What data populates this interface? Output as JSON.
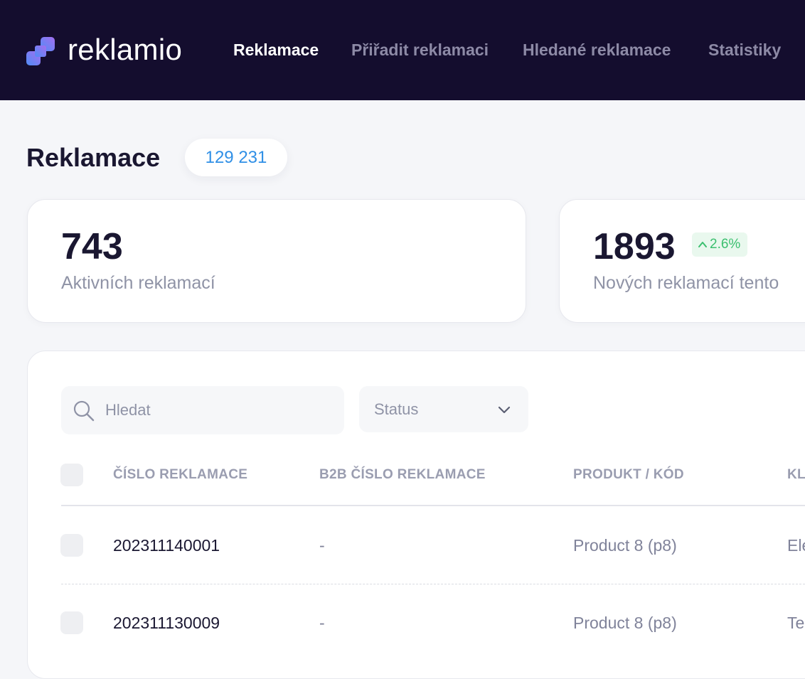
{
  "app": {
    "brand": "reklamio",
    "colors": {
      "nav_background": "#140d2e",
      "accent_blue": "#2f8fe6",
      "trend_green": "#3bbf6f",
      "logo_gradient": [
        "#4f8df6",
        "#a46ef0"
      ]
    }
  },
  "nav": {
    "items": [
      {
        "label": "Reklamace",
        "active": true
      },
      {
        "label": "Přiřadit reklamaci",
        "active": false
      },
      {
        "label": "Hledané reklamace",
        "active": false
      },
      {
        "label": "Statistiky",
        "active": false
      }
    ]
  },
  "page": {
    "title": "Reklamace",
    "total_count": "129 231"
  },
  "stats": [
    {
      "value": "743",
      "label": "Aktivních reklamací"
    },
    {
      "value": "1893",
      "label": "Nových reklamací tento",
      "trend": "2.6%",
      "trend_direction": "up",
      "trend_icon": "arrow-up-icon"
    }
  ],
  "filters": {
    "search_placeholder": "Hledat",
    "search_value": "",
    "search_icon": "search-icon",
    "status_label": "Status",
    "status_icon": "chevron-down-icon"
  },
  "table": {
    "columns": [
      "ČÍSLO REKLAMACE",
      "B2B ČÍSLO REKLAMACE",
      "PRODUKT / KÓD",
      "KL"
    ],
    "rows": [
      {
        "number": "202311140001",
        "b2b": "-",
        "product": "Product 8 (p8)",
        "customer": "Ele"
      },
      {
        "number": "202311130009",
        "b2b": "-",
        "product": "Product 8 (p8)",
        "customer": "Te"
      }
    ]
  }
}
